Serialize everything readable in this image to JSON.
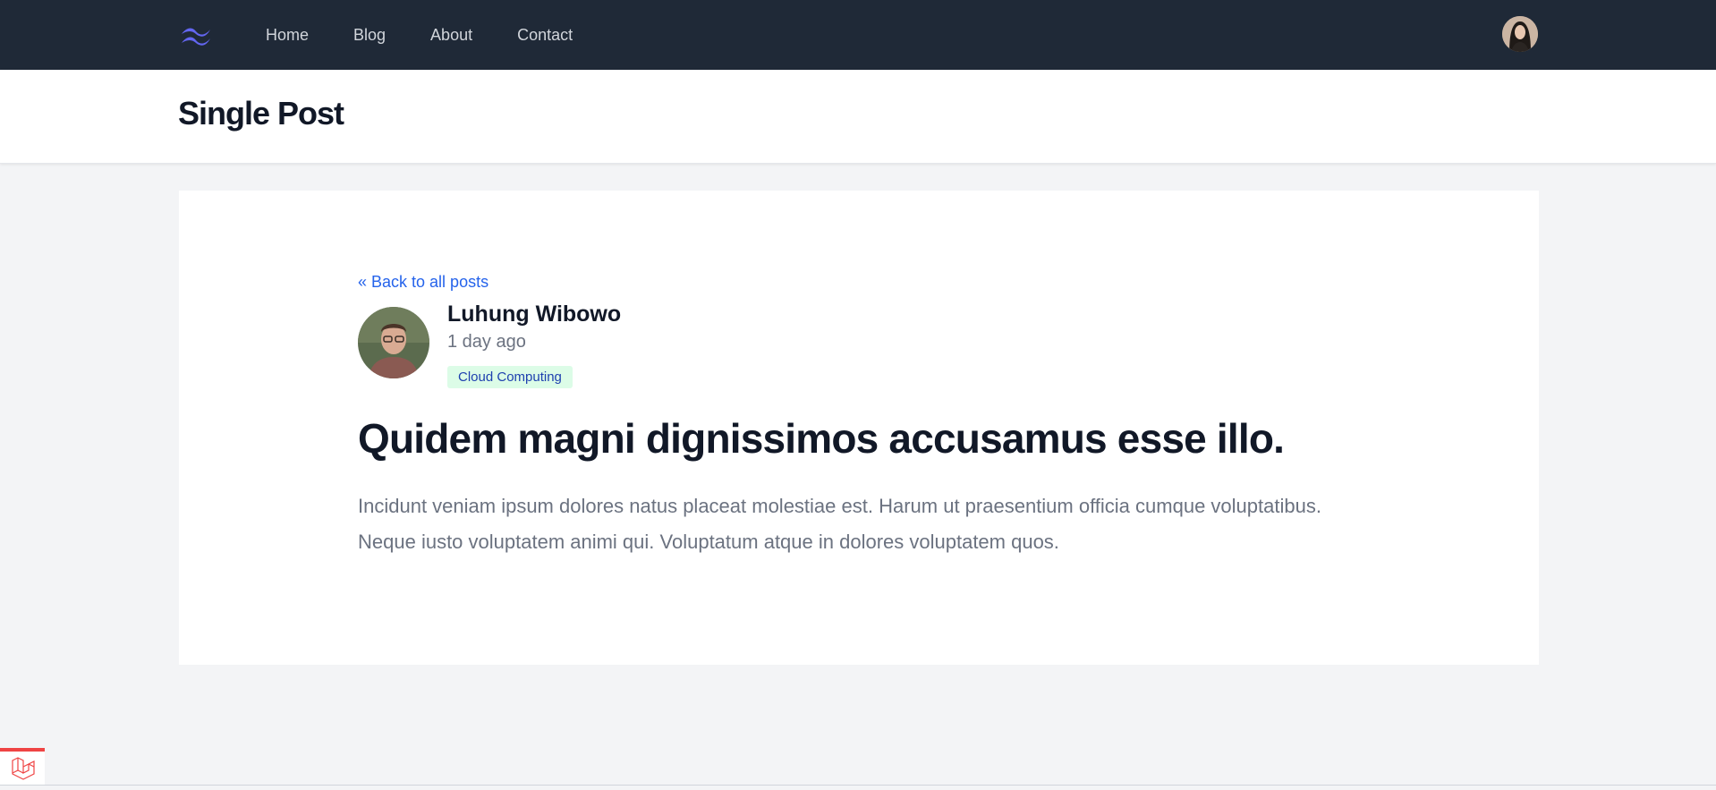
{
  "nav": {
    "logo_icon": "tailwind-logo-icon",
    "links": [
      {
        "label": "Home"
      },
      {
        "label": "Blog"
      },
      {
        "label": "About"
      },
      {
        "label": "Contact"
      }
    ],
    "user_avatar_icon": "user-avatar"
  },
  "header": {
    "title": "Single Post"
  },
  "post": {
    "back_link": "« Back to all posts",
    "author": "Luhung Wibowo",
    "date": "1 day ago",
    "category": "Cloud Computing",
    "title": "Quidem magni dignissimos accusamus esse illo.",
    "body": "Incidunt veniam ipsum dolores natus placeat molestiae est. Harum ut praesentium officia cumque voluptatibus. Neque iusto voluptatem animi qui. Voluptatum atque in dolores voluptatem quos."
  },
  "colors": {
    "nav_bg": "#1f2937",
    "accent_link": "#2563eb",
    "badge_bg": "#dcfce7",
    "badge_text": "#1e40af",
    "page_bg": "#f3f4f6"
  },
  "footer": {
    "laravel_icon": "laravel-logo-icon"
  }
}
